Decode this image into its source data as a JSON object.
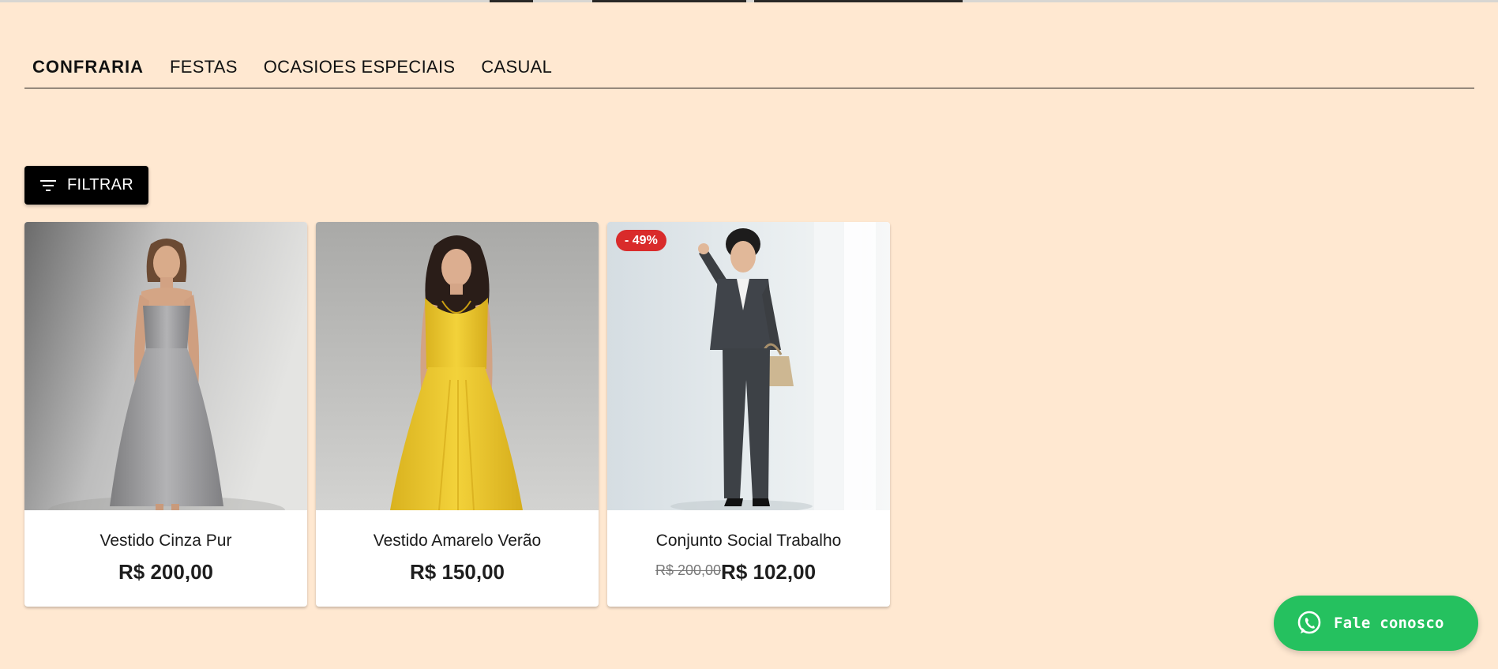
{
  "tabs": [
    {
      "label": "CONFRARIA",
      "active": true
    },
    {
      "label": "FESTAS",
      "active": false
    },
    {
      "label": "OCASIOES ESPECIAIS",
      "active": false
    },
    {
      "label": "CASUAL",
      "active": false
    }
  ],
  "filter": {
    "label": "FILTRAR",
    "icon": "filter-list-icon"
  },
  "products": [
    {
      "name": "Vestido Cinza Pur",
      "price": "R$ 200,00",
      "image": "model in gray strapless midi dress"
    },
    {
      "name": "Vestido Amarelo Verão",
      "price": "R$ 150,00",
      "image": "model in yellow lace maxi dress"
    },
    {
      "name": "Conjunto Social Trabalho",
      "old_price": "R$ 200,00",
      "price": "R$ 102,00",
      "badge": "- 49%",
      "image": "woman in dark gray pantsuit with handbag"
    }
  ],
  "whatsapp": {
    "label": "Fale conosco",
    "icon": "whatsapp-icon"
  },
  "colors": {
    "background": "#ffe8d1",
    "button": "#000000",
    "badge": "#d92b2b",
    "whatsapp": "#25c15f"
  }
}
